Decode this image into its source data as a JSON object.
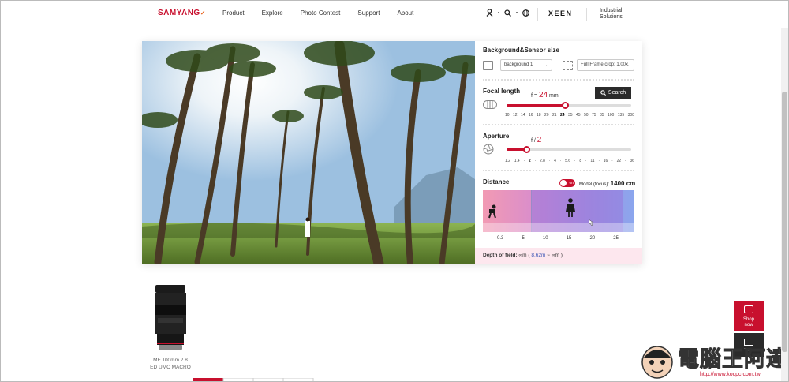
{
  "header": {
    "logo": "SAMYANG",
    "logo_mark": "✓",
    "nav": [
      "Product",
      "Explore",
      "Photo Contest",
      "Support",
      "About"
    ],
    "xeen": "XEEN",
    "industrial_line1": "Industrial",
    "industrial_line2": "Solutions"
  },
  "panel": {
    "bg_title": "Background&Sensor size",
    "bg_select": "background 1",
    "sensor_select": "Full Frame crop: 1.00x",
    "focal_title": "Focal length",
    "focal_prefix": "f =",
    "focal_value": "24",
    "focal_unit": "mm",
    "search_label": "Search",
    "focal_ticks": [
      "10",
      "12",
      "14",
      "16",
      "18",
      "20",
      "21",
      "24",
      "35",
      "45",
      "50",
      "75",
      "85",
      "100",
      "135",
      "300"
    ],
    "focal_selected_index": 7,
    "focal_fraction": 0.47,
    "aperture_title": "Aperture",
    "aperture_prefix": "f /",
    "aperture_value": "2",
    "aperture_ticks": [
      "1.2",
      "1.4",
      "·",
      "2",
      "·",
      "2.8",
      "·",
      "4",
      "·",
      "5.6",
      "·",
      "8",
      "·",
      "11",
      "·",
      "16",
      "·",
      "22",
      "·",
      "36"
    ],
    "aperture_fraction": 0.16,
    "distance_title": "Distance",
    "toggle_label": "on",
    "model_label": "Model (focus):",
    "model_value": "1400 cm",
    "distance_ticks": [
      "0.3",
      "5",
      "10",
      "15",
      "20",
      "25"
    ],
    "dof_label": "Depth of field:",
    "dof_near": "∞m",
    "dof_range": "8.62m",
    "dof_far": "∞m"
  },
  "product": {
    "name_line1": "MF 100mm 2.8",
    "name_line2": "ED UMC MACRO"
  },
  "widgets": {
    "shop_line1": "Shop",
    "shop_line2": "now",
    "tube_label": "Tube"
  },
  "watermark": {
    "text": "電腦王阿達",
    "url": "http://www.kocpc.com.tw"
  },
  "colors": {
    "brand_red": "#c8102e",
    "accent_orange": "#e8641f",
    "dof_blue": "#3a55b5"
  }
}
